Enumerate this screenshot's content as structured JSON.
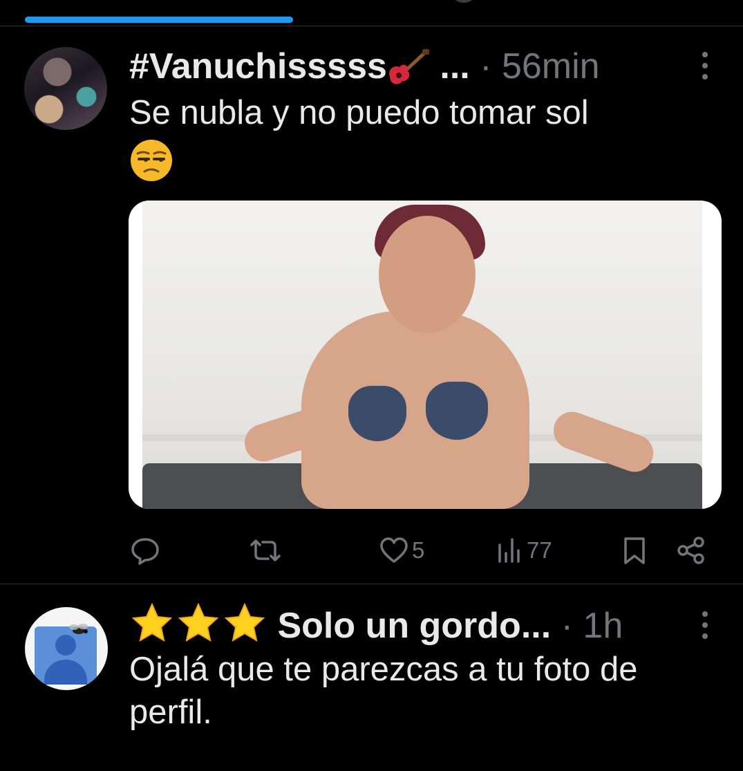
{
  "tweets": [
    {
      "display_name": "#Vanuchisssss",
      "name_suffix": " ...",
      "separator": "·",
      "time": "56min",
      "text": "Se nubla y no puedo tomar sol",
      "emoji": "unamused-face",
      "has_media": true,
      "actions": {
        "reply_count": "",
        "retweet_count": "",
        "like_count": "5",
        "view_count": "77"
      },
      "name_icon": "guitar-emoji"
    },
    {
      "display_name": "Solo un gordo...",
      "name_prefix_icon": "three-stars-emoji",
      "separator": "·",
      "time": "1h",
      "text": "Ojalá que te parezcas a tu foto de perfil."
    }
  ],
  "colors": {
    "background": "#000000",
    "text": "#e7e9ea",
    "muted": "#71767b",
    "accent": "#1d9bf0",
    "divider": "#2f3336"
  }
}
